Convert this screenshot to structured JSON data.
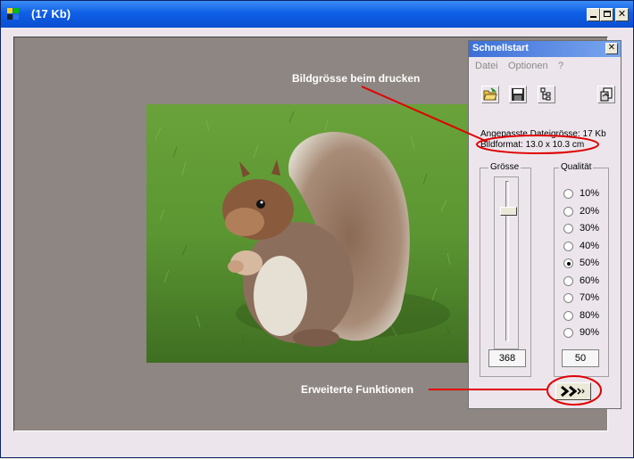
{
  "window": {
    "title": "(17 Kb)"
  },
  "annotations": {
    "print_size_note": "Bildgrösse beim drucken",
    "advanced_note": "Erweiterte Funktionen"
  },
  "panel": {
    "title": "Schnellstart",
    "close_glyph": "✕",
    "menu": [
      "Datei",
      "Optionen",
      "?"
    ],
    "toolbar_icons": [
      "open-folder-icon",
      "save-disk-icon",
      "tree-icon",
      "export-icon"
    ],
    "info_line1": "Angepasste Dateigrösse: 17 Kb",
    "info_line2": "Bildformat: 13.0 x 10.3 cm",
    "size_group_label": "Grösse",
    "size_value": "368",
    "quality_group_label": "Qualität",
    "quality_options": [
      "10%",
      "20%",
      "30%",
      "40%",
      "50%",
      "60%",
      "70%",
      "80%",
      "90%"
    ],
    "quality_selected": "50%",
    "quality_value": "50",
    "advanced_button": "»"
  },
  "colors": {
    "title_bar": "#0a4fd1",
    "canvas": "#8e8682",
    "annotation_red": "#e00000"
  }
}
